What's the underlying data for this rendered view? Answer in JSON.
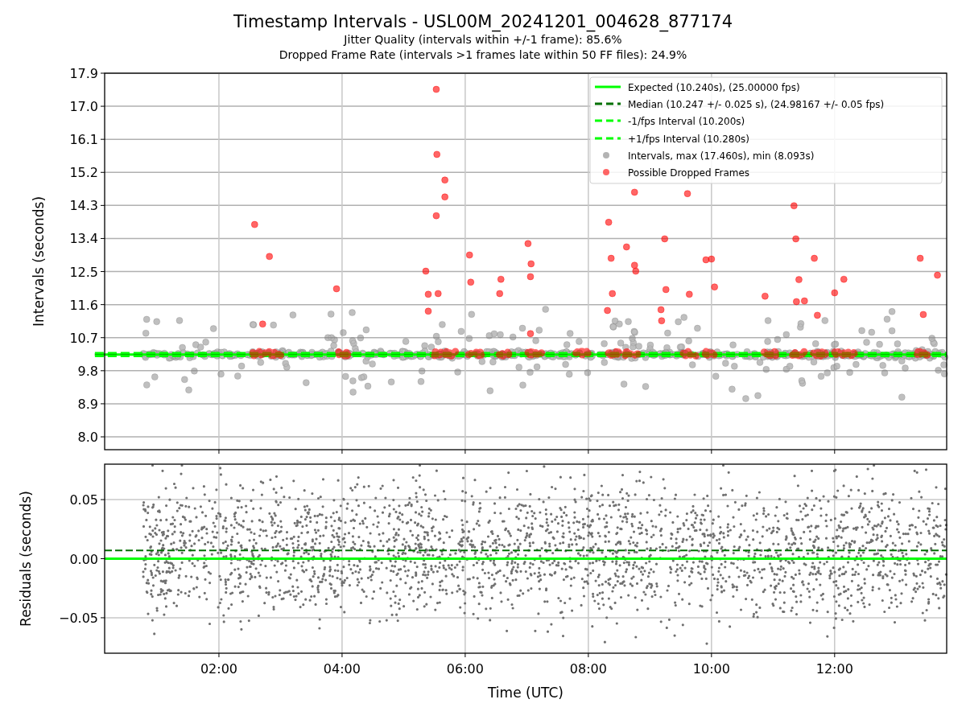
{
  "figure": {
    "title": "Timestamp Intervals - USL00M_20241201_004628_877174",
    "subtitles": [
      "Jitter Quality (intervals within +/-1 frame): 85.6%",
      "Dropped Frame Rate (intervals >1 frames late within 50 FF files): 24.9%"
    ]
  },
  "charts": [
    {
      "chart_data": {
        "type": "scatter",
        "ylabel": "Intervals (seconds)",
        "grid": true,
        "legend": "upper right",
        "xlim": [
          0.144,
          13.82
        ],
        "ylim": [
          7.65,
          17.9
        ],
        "yticks": [
          {
            "value": 8.0,
            "label": "8.0"
          },
          {
            "value": 8.9,
            "label": "8.9"
          },
          {
            "value": 9.8,
            "label": "9.8"
          },
          {
            "value": 10.7,
            "label": "10.7"
          },
          {
            "value": 11.6,
            "label": "11.6"
          },
          {
            "value": 12.5,
            "label": "12.5"
          },
          {
            "value": 13.4,
            "label": "13.4"
          },
          {
            "value": 14.3,
            "label": "14.3"
          },
          {
            "value": 15.2,
            "label": "15.2"
          },
          {
            "value": 16.1,
            "label": "16.1"
          },
          {
            "value": 17.0,
            "label": "17.0"
          },
          {
            "value": 17.9,
            "label": "17.9"
          }
        ],
        "x": [
          2.58,
          2.82,
          2.71,
          3.91,
          5.53,
          5.54,
          5.67,
          5.67,
          5.53,
          5.36,
          5.4,
          5.4,
          5.56,
          6.07,
          6.09,
          6.58,
          6.56,
          7.02,
          7.07,
          7.06,
          7.06,
          8.33,
          8.37,
          8.39,
          8.31,
          8.62,
          8.75,
          8.75,
          8.77,
          9.24,
          9.26,
          9.18,
          9.19,
          9.64,
          9.61,
          9.91,
          10.0,
          10.05,
          10.87,
          11.34,
          11.37,
          11.42,
          11.38,
          11.51,
          11.67,
          11.72,
          12.0,
          12.15,
          13.39,
          13.44,
          13.67
        ],
        "series": [
          {
            "name": "Possible Dropped Frames",
            "color": "#ff0000",
            "values": [
              13.78,
              12.91,
              11.07,
              12.03,
              17.46,
              15.69,
              14.99,
              14.53,
              14.02,
              12.51,
              11.88,
              11.42,
              11.9,
              12.95,
              12.21,
              12.29,
              11.9,
              13.26,
              12.71,
              12.36,
              10.81,
              13.84,
              12.86,
              11.9,
              11.44,
              13.17,
              14.66,
              12.67,
              12.51,
              13.39,
              12.01,
              11.46,
              11.16,
              11.88,
              14.62,
              12.82,
              12.84,
              12.08,
              11.83,
              14.29,
              13.39,
              12.28,
              11.68,
              11.7,
              12.86,
              11.31,
              11.92,
              12.29,
              12.86,
              11.33,
              12.4
            ]
          }
        ],
        "ref_lines": [
          {
            "axis": "y",
            "value": 10.24,
            "label": "Expected (10.240s), (25.00000 fps)",
            "color": "#00ff00"
          },
          {
            "axis": "y",
            "value": 10.247,
            "label": "Median (10.247 +/- 0.025 s), (24.98167 +/- 0.05 fps)",
            "color": "#007000"
          },
          {
            "axis": "y",
            "value": 10.2,
            "label": "-1/fps Interval (10.200s)",
            "color": "#00ff00"
          },
          {
            "axis": "y",
            "value": 10.28,
            "label": "+1/fps Interval (10.280s)",
            "color": "#00ff00"
          }
        ]
      },
      "legend": [
        {
          "label": "Intervals, max (17.460s), min (8.093s)",
          "color": "#b3b3b3"
        }
      ]
    },
    {
      "chart_data": {
        "type": "scatter",
        "xlabel": "Time (UTC)",
        "ylabel": "Residuals (seconds)",
        "grid": true,
        "xlim": [
          0.144,
          13.82
        ],
        "ylim": [
          -0.08,
          0.08
        ],
        "xticks": [
          {
            "value": 2,
            "label": "02:00"
          },
          {
            "value": 4,
            "label": "04:00"
          },
          {
            "value": 6,
            "label": "06:00"
          },
          {
            "value": 8,
            "label": "08:00"
          },
          {
            "value": 10,
            "label": "10:00"
          },
          {
            "value": 12,
            "label": "12:00"
          }
        ],
        "yticks": [
          {
            "value": -0.05,
            "label": "−0.05"
          },
          {
            "value": 0,
            "label": "0.00"
          },
          {
            "value": 0.05,
            "label": "0.05"
          }
        ],
        "ref_lines": [
          {
            "axis": "y",
            "value": 0.007,
            "color": "#007000"
          },
          {
            "axis": "y",
            "value": 0,
            "color": "#00ff00"
          }
        ]
      }
    }
  ]
}
